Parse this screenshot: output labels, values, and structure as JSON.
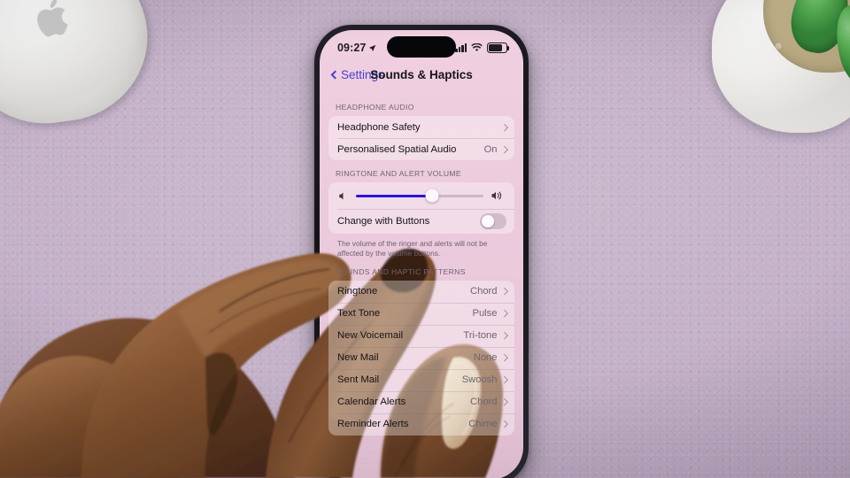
{
  "scene": {
    "description": "Hand holding iPhone showing iOS Sounds & Haptics settings on a lavender desk",
    "desk_color": "#c3b0c8",
    "objects": [
      {
        "name": "magic-mouse",
        "label": "Apple Magic Mouse",
        "color": "#f4f3f1"
      },
      {
        "name": "plant-pot",
        "label": "White ceramic pot with succulent",
        "color": "#f2f1ed"
      }
    ]
  },
  "phone": {
    "status_bar": {
      "time": "09:27",
      "location_icon": "location-arrow-icon",
      "cellular_icon": "cellular-bars-icon",
      "wifi_icon": "wifi-icon",
      "battery_icon": "battery-icon",
      "battery_level": 78
    },
    "nav": {
      "back_label": "Settings",
      "back_icon": "chevron-left-icon",
      "title": "Sounds & Haptics"
    },
    "sections": [
      {
        "id": "headphone-audio",
        "header": "HEADPHONE AUDIO",
        "rows": [
          {
            "label": "Headphone Safety",
            "value": "",
            "chevron": true
          },
          {
            "label": "Personalised Spatial Audio",
            "value": "On",
            "chevron": true
          }
        ]
      },
      {
        "id": "ringtone-alert-volume",
        "header": "RINGTONE AND ALERT VOLUME",
        "slider": {
          "name": "ringtone-volume-slider",
          "value": 60,
          "min": 0,
          "max": 100,
          "fill_color": "#2a13e0",
          "left_icon": "speaker-low-icon",
          "right_icon": "speaker-high-icon"
        },
        "toggle_row": {
          "label": "Change with Buttons",
          "name": "change-with-buttons-toggle",
          "state": "off"
        },
        "footnote": "The volume of the ringer and alerts will not be affected by the volume buttons."
      },
      {
        "id": "sounds-haptic-patterns",
        "header": "SOUNDS AND HAPTIC PATTERNS",
        "rows": [
          {
            "label": "Ringtone",
            "value": "Chord",
            "chevron": true
          },
          {
            "label": "Text Tone",
            "value": "Pulse",
            "chevron": true
          },
          {
            "label": "New Voicemail",
            "value": "Tri-tone",
            "chevron": true
          },
          {
            "label": "New Mail",
            "value": "None",
            "chevron": true
          },
          {
            "label": "Sent Mail",
            "value": "Swoosh",
            "chevron": true
          },
          {
            "label": "Calendar Alerts",
            "value": "Chord",
            "chevron": true
          },
          {
            "label": "Reminder Alerts",
            "value": "Chime",
            "chevron": true
          }
        ]
      }
    ]
  }
}
